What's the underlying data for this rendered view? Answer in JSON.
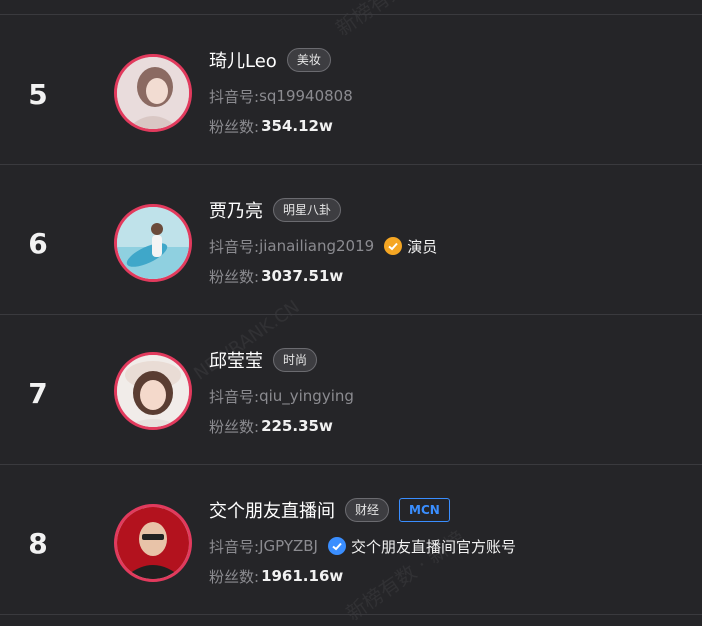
{
  "rows": [
    {
      "rank": "5",
      "name": "琦儿Leo",
      "tag": "美妆",
      "account_label": "抖音号:",
      "account_id": "sq19940808",
      "fans_label": "粉丝数:",
      "fans": "354.12w"
    },
    {
      "rank": "6",
      "name": "贾乃亮",
      "tag": "明星八卦",
      "account_label": "抖音号:",
      "account_id": "jianailiang2019",
      "verify_text": "演员",
      "verify_color": "#f5a623",
      "fans_label": "粉丝数:",
      "fans": "3037.51w"
    },
    {
      "rank": "7",
      "name": "邱莹莹",
      "tag": "时尚",
      "account_label": "抖音号:",
      "account_id": "qiu_yingying",
      "fans_label": "粉丝数:",
      "fans": "225.35w"
    },
    {
      "rank": "8",
      "name": "交个朋友直播间",
      "tag": "财经",
      "badge": "MCN",
      "account_label": "抖音号:",
      "account_id": "JGPYZBJ",
      "verify_text": "交个朋友直播间官方账号",
      "verify_color": "#3a8eff",
      "fans_label": "粉丝数:",
      "fans": "1961.16w"
    }
  ],
  "watermarks": [
    "新榜有数",
    "NEWRANK.CN",
    "新榜有数 · 新榜"
  ],
  "colors": {
    "background": "#252528",
    "avatar_ring": "#e23a5d",
    "mcn_blue": "#3a8eff",
    "verify_gold": "#f5a623"
  }
}
